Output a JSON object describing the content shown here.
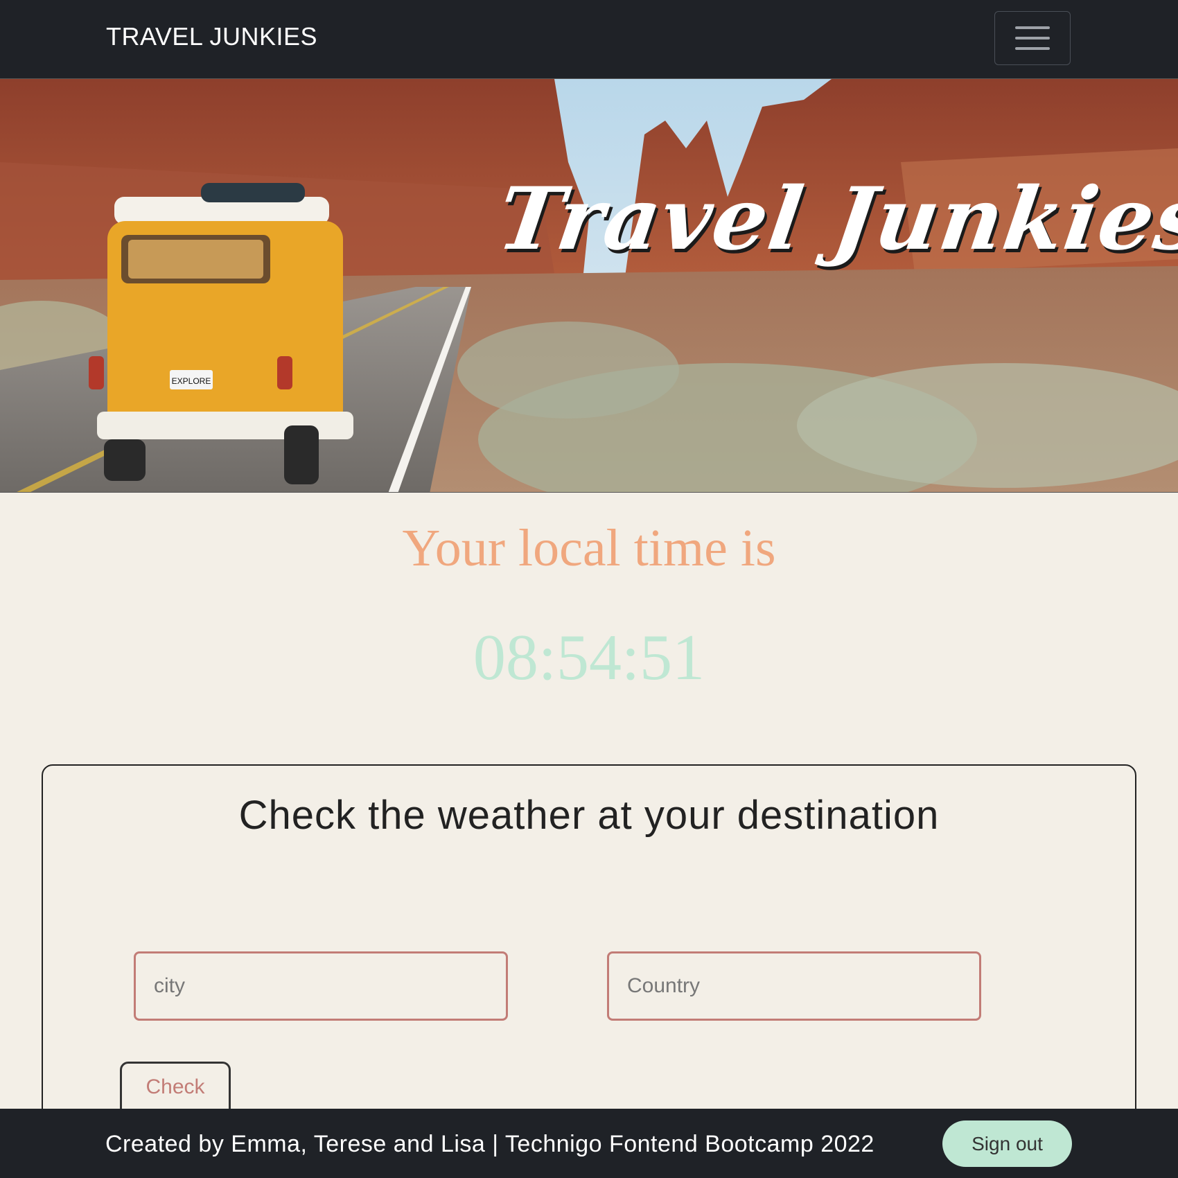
{
  "navbar": {
    "brand": "TRAVEL JUNKIES",
    "menu_icon": "hamburger-menu-icon"
  },
  "hero": {
    "title": "Travel Junkies",
    "license_plate": "EXPLORE"
  },
  "time": {
    "label": "Your local time is",
    "value": "08:54:51"
  },
  "weather": {
    "title": "Check the weather at your destination",
    "city_placeholder": "city",
    "country_placeholder": "Country",
    "check_label": "Check"
  },
  "footer": {
    "credit": "Created by Emma, Terese and Lisa | Technigo Fontend Bootcamp 2022",
    "signout_label": "Sign out"
  },
  "colors": {
    "page_bg": "#f3efe7",
    "nav_bg": "#1f2227",
    "accent_orange": "#f0a77e",
    "accent_mint": "#bfe7d3",
    "input_border": "#c27c76"
  }
}
